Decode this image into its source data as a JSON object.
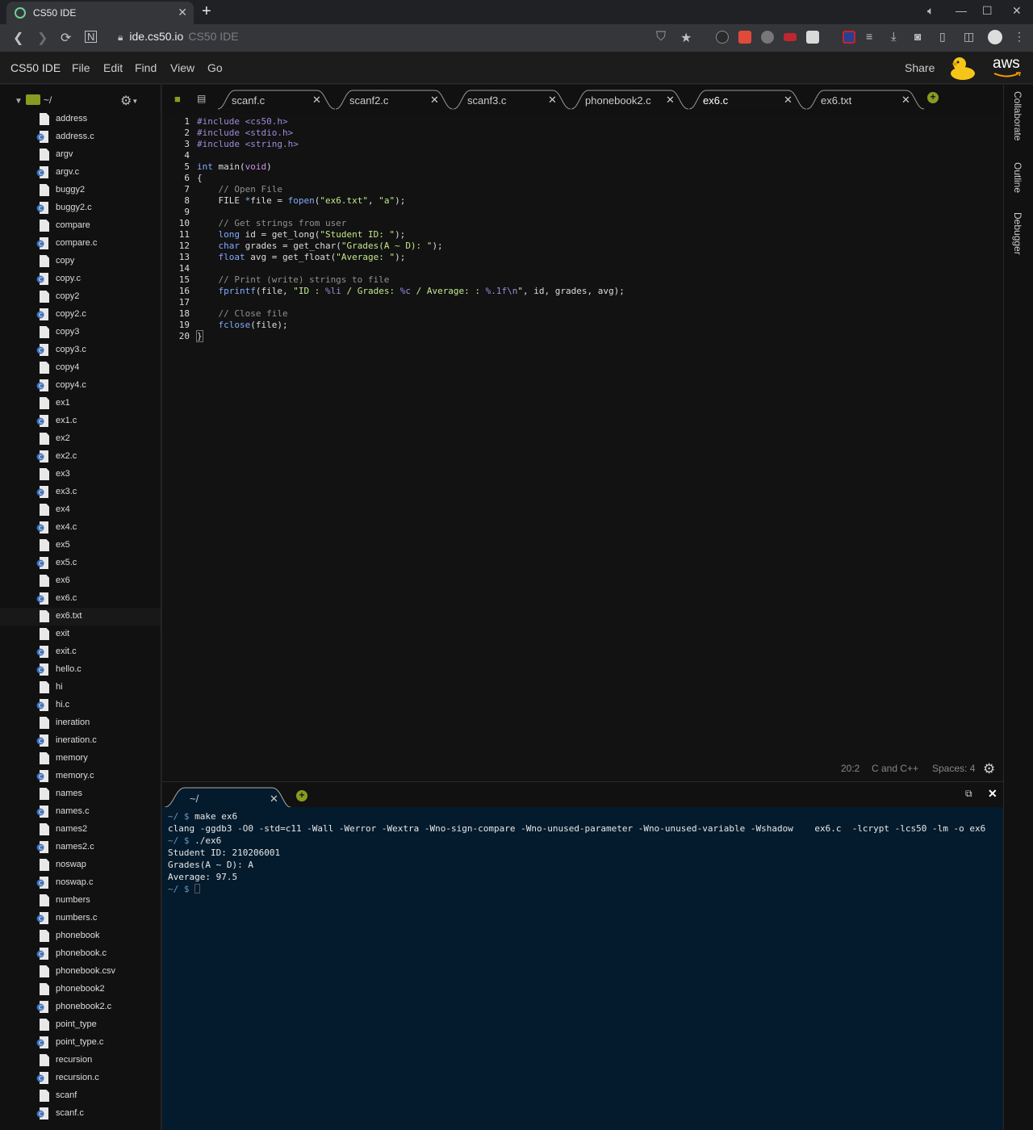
{
  "browser": {
    "tab_title": "CS50 IDE",
    "url_host": "ide.cs50.io",
    "url_page_title": "CS50 IDE"
  },
  "menu": {
    "brand": "CS50 IDE",
    "items": [
      "File",
      "Edit",
      "Find",
      "View",
      "Go"
    ],
    "share": "Share",
    "aws": "aws"
  },
  "tree": {
    "root": "~/",
    "files": [
      {
        "name": "address",
        "type": "file"
      },
      {
        "name": "address.c",
        "type": "c"
      },
      {
        "name": "argv",
        "type": "file"
      },
      {
        "name": "argv.c",
        "type": "c"
      },
      {
        "name": "buggy2",
        "type": "file"
      },
      {
        "name": "buggy2.c",
        "type": "c"
      },
      {
        "name": "compare",
        "type": "file"
      },
      {
        "name": "compare.c",
        "type": "c"
      },
      {
        "name": "copy",
        "type": "file"
      },
      {
        "name": "copy.c",
        "type": "c"
      },
      {
        "name": "copy2",
        "type": "file"
      },
      {
        "name": "copy2.c",
        "type": "c"
      },
      {
        "name": "copy3",
        "type": "file"
      },
      {
        "name": "copy3.c",
        "type": "c"
      },
      {
        "name": "copy4",
        "type": "file"
      },
      {
        "name": "copy4.c",
        "type": "c"
      },
      {
        "name": "ex1",
        "type": "file"
      },
      {
        "name": "ex1.c",
        "type": "c"
      },
      {
        "name": "ex2",
        "type": "file"
      },
      {
        "name": "ex2.c",
        "type": "c"
      },
      {
        "name": "ex3",
        "type": "file"
      },
      {
        "name": "ex3.c",
        "type": "c"
      },
      {
        "name": "ex4",
        "type": "file"
      },
      {
        "name": "ex4.c",
        "type": "c"
      },
      {
        "name": "ex5",
        "type": "file"
      },
      {
        "name": "ex5.c",
        "type": "c"
      },
      {
        "name": "ex6",
        "type": "file"
      },
      {
        "name": "ex6.c",
        "type": "c"
      },
      {
        "name": "ex6.txt",
        "type": "file",
        "selected": true
      },
      {
        "name": "exit",
        "type": "file"
      },
      {
        "name": "exit.c",
        "type": "c"
      },
      {
        "name": "hello.c",
        "type": "c"
      },
      {
        "name": "hi",
        "type": "file"
      },
      {
        "name": "hi.c",
        "type": "c"
      },
      {
        "name": "ineration",
        "type": "file"
      },
      {
        "name": "ineration.c",
        "type": "c"
      },
      {
        "name": "memory",
        "type": "file"
      },
      {
        "name": "memory.c",
        "type": "c"
      },
      {
        "name": "names",
        "type": "file"
      },
      {
        "name": "names.c",
        "type": "c"
      },
      {
        "name": "names2",
        "type": "file"
      },
      {
        "name": "names2.c",
        "type": "c"
      },
      {
        "name": "noswap",
        "type": "file"
      },
      {
        "name": "noswap.c",
        "type": "c"
      },
      {
        "name": "numbers",
        "type": "file"
      },
      {
        "name": "numbers.c",
        "type": "c"
      },
      {
        "name": "phonebook",
        "type": "file"
      },
      {
        "name": "phonebook.c",
        "type": "c"
      },
      {
        "name": "phonebook.csv",
        "type": "file"
      },
      {
        "name": "phonebook2",
        "type": "file"
      },
      {
        "name": "phonebook2.c",
        "type": "c"
      },
      {
        "name": "point_type",
        "type": "file"
      },
      {
        "name": "point_type.c",
        "type": "c"
      },
      {
        "name": "recursion",
        "type": "file"
      },
      {
        "name": "recursion.c",
        "type": "c"
      },
      {
        "name": "scanf",
        "type": "file"
      },
      {
        "name": "scanf.c",
        "type": "c"
      }
    ]
  },
  "editor_tabs": [
    {
      "label": "scanf.c",
      "active": false
    },
    {
      "label": "scanf2.c",
      "active": false
    },
    {
      "label": "scanf3.c",
      "active": false
    },
    {
      "label": "phonebook2.c",
      "active": false
    },
    {
      "label": "ex6.c",
      "active": true
    },
    {
      "label": "ex6.txt",
      "active": false
    }
  ],
  "code_lines": [
    "#include <cs50.h>",
    "#include <stdio.h>",
    "#include <string.h>",
    "",
    "int main(void)",
    "{",
    "    // Open File",
    "    FILE *file = fopen(\"ex6.txt\", \"a\");",
    "",
    "    // Get strings from user",
    "    long id = get_long(\"Student ID: \");",
    "    char grades = get_char(\"Grades(A ~ D): \");",
    "    float avg = get_float(\"Average: \");",
    "",
    "    // Print (write) strings to file",
    "    fprintf(file, \"ID : %li / Grades: %c / Average: : %.1f\\n\", id, grades, avg);",
    "",
    "    // Close file",
    "    fclose(file);",
    "}"
  ],
  "status": {
    "position": "20:2",
    "language": "C and C++",
    "spaces": "Spaces: 4"
  },
  "right_panel": [
    "Collaborate",
    "Outline",
    "Debugger"
  ],
  "terminal": {
    "tab_label": "~/",
    "lines": [
      {
        "prompt": "~/ $",
        "text": " make ex6"
      },
      {
        "prompt": "",
        "text": "clang -ggdb3 -O0 -std=c11 -Wall -Werror -Wextra -Wno-sign-compare -Wno-unused-parameter -Wno-unused-variable -Wshadow    ex6.c  -lcrypt -lcs50 -lm -o ex6"
      },
      {
        "prompt": "~/ $",
        "text": " ./ex6"
      },
      {
        "prompt": "",
        "text": "Student ID: 210206001"
      },
      {
        "prompt": "",
        "text": "Grades(A ~ D): A"
      },
      {
        "prompt": "",
        "text": "Average: 97.5"
      },
      {
        "prompt": "~/ $",
        "text": " "
      }
    ]
  }
}
